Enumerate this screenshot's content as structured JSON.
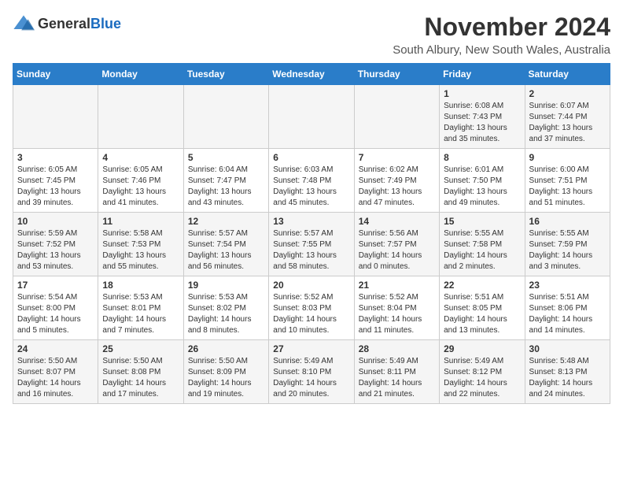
{
  "header": {
    "logo_general": "General",
    "logo_blue": "Blue",
    "title": "November 2024",
    "subtitle": "South Albury, New South Wales, Australia"
  },
  "calendar": {
    "days_of_week": [
      "Sunday",
      "Monday",
      "Tuesday",
      "Wednesday",
      "Thursday",
      "Friday",
      "Saturday"
    ],
    "weeks": [
      [
        {
          "day": "",
          "details": ""
        },
        {
          "day": "",
          "details": ""
        },
        {
          "day": "",
          "details": ""
        },
        {
          "day": "",
          "details": ""
        },
        {
          "day": "",
          "details": ""
        },
        {
          "day": "1",
          "details": "Sunrise: 6:08 AM\nSunset: 7:43 PM\nDaylight: 13 hours\nand 35 minutes."
        },
        {
          "day": "2",
          "details": "Sunrise: 6:07 AM\nSunset: 7:44 PM\nDaylight: 13 hours\nand 37 minutes."
        }
      ],
      [
        {
          "day": "3",
          "details": "Sunrise: 6:05 AM\nSunset: 7:45 PM\nDaylight: 13 hours\nand 39 minutes."
        },
        {
          "day": "4",
          "details": "Sunrise: 6:05 AM\nSunset: 7:46 PM\nDaylight: 13 hours\nand 41 minutes."
        },
        {
          "day": "5",
          "details": "Sunrise: 6:04 AM\nSunset: 7:47 PM\nDaylight: 13 hours\nand 43 minutes."
        },
        {
          "day": "6",
          "details": "Sunrise: 6:03 AM\nSunset: 7:48 PM\nDaylight: 13 hours\nand 45 minutes."
        },
        {
          "day": "7",
          "details": "Sunrise: 6:02 AM\nSunset: 7:49 PM\nDaylight: 13 hours\nand 47 minutes."
        },
        {
          "day": "8",
          "details": "Sunrise: 6:01 AM\nSunset: 7:50 PM\nDaylight: 13 hours\nand 49 minutes."
        },
        {
          "day": "9",
          "details": "Sunrise: 6:00 AM\nSunset: 7:51 PM\nDaylight: 13 hours\nand 51 minutes."
        }
      ],
      [
        {
          "day": "10",
          "details": "Sunrise: 5:59 AM\nSunset: 7:52 PM\nDaylight: 13 hours\nand 53 minutes."
        },
        {
          "day": "11",
          "details": "Sunrise: 5:58 AM\nSunset: 7:53 PM\nDaylight: 13 hours\nand 55 minutes."
        },
        {
          "day": "12",
          "details": "Sunrise: 5:57 AM\nSunset: 7:54 PM\nDaylight: 13 hours\nand 56 minutes."
        },
        {
          "day": "13",
          "details": "Sunrise: 5:57 AM\nSunset: 7:55 PM\nDaylight: 13 hours\nand 58 minutes."
        },
        {
          "day": "14",
          "details": "Sunrise: 5:56 AM\nSunset: 7:57 PM\nDaylight: 14 hours\nand 0 minutes."
        },
        {
          "day": "15",
          "details": "Sunrise: 5:55 AM\nSunset: 7:58 PM\nDaylight: 14 hours\nand 2 minutes."
        },
        {
          "day": "16",
          "details": "Sunrise: 5:55 AM\nSunset: 7:59 PM\nDaylight: 14 hours\nand 3 minutes."
        }
      ],
      [
        {
          "day": "17",
          "details": "Sunrise: 5:54 AM\nSunset: 8:00 PM\nDaylight: 14 hours\nand 5 minutes."
        },
        {
          "day": "18",
          "details": "Sunrise: 5:53 AM\nSunset: 8:01 PM\nDaylight: 14 hours\nand 7 minutes."
        },
        {
          "day": "19",
          "details": "Sunrise: 5:53 AM\nSunset: 8:02 PM\nDaylight: 14 hours\nand 8 minutes."
        },
        {
          "day": "20",
          "details": "Sunrise: 5:52 AM\nSunset: 8:03 PM\nDaylight: 14 hours\nand 10 minutes."
        },
        {
          "day": "21",
          "details": "Sunrise: 5:52 AM\nSunset: 8:04 PM\nDaylight: 14 hours\nand 11 minutes."
        },
        {
          "day": "22",
          "details": "Sunrise: 5:51 AM\nSunset: 8:05 PM\nDaylight: 14 hours\nand 13 minutes."
        },
        {
          "day": "23",
          "details": "Sunrise: 5:51 AM\nSunset: 8:06 PM\nDaylight: 14 hours\nand 14 minutes."
        }
      ],
      [
        {
          "day": "24",
          "details": "Sunrise: 5:50 AM\nSunset: 8:07 PM\nDaylight: 14 hours\nand 16 minutes."
        },
        {
          "day": "25",
          "details": "Sunrise: 5:50 AM\nSunset: 8:08 PM\nDaylight: 14 hours\nand 17 minutes."
        },
        {
          "day": "26",
          "details": "Sunrise: 5:50 AM\nSunset: 8:09 PM\nDaylight: 14 hours\nand 19 minutes."
        },
        {
          "day": "27",
          "details": "Sunrise: 5:49 AM\nSunset: 8:10 PM\nDaylight: 14 hours\nand 20 minutes."
        },
        {
          "day": "28",
          "details": "Sunrise: 5:49 AM\nSunset: 8:11 PM\nDaylight: 14 hours\nand 21 minutes."
        },
        {
          "day": "29",
          "details": "Sunrise: 5:49 AM\nSunset: 8:12 PM\nDaylight: 14 hours\nand 22 minutes."
        },
        {
          "day": "30",
          "details": "Sunrise: 5:48 AM\nSunset: 8:13 PM\nDaylight: 14 hours\nand 24 minutes."
        }
      ]
    ]
  }
}
